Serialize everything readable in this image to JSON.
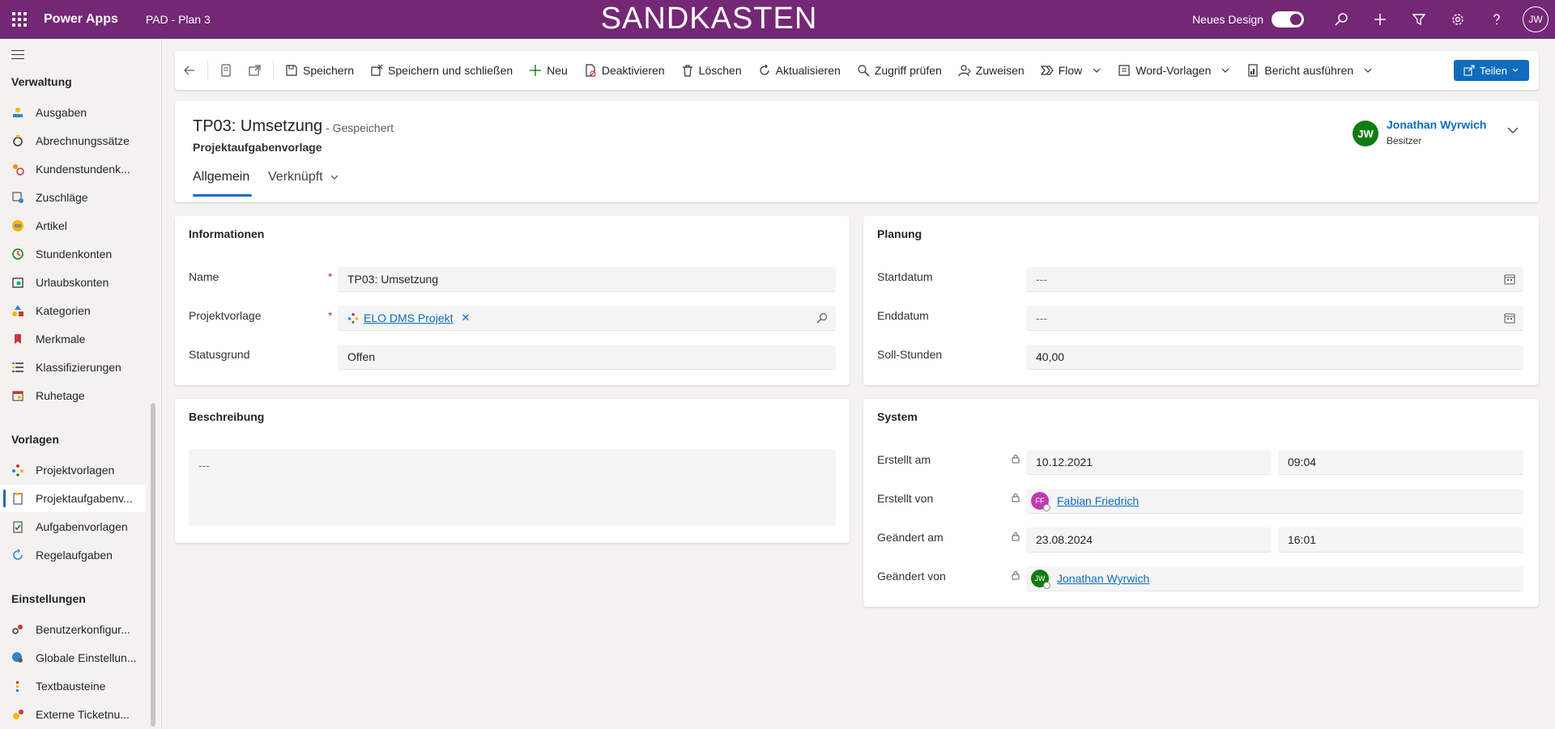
{
  "topbar": {
    "app_name": "Power Apps",
    "app_sub": "PAD - Plan 3",
    "env_title": "SANDKASTEN",
    "new_design_label": "Neues Design",
    "new_design_on": true,
    "user_initials": "JW"
  },
  "sidebar": {
    "groups": [
      {
        "label": "Verwaltung"
      },
      {
        "label": "Vorlagen"
      },
      {
        "label": "Einstellungen"
      }
    ],
    "items": [
      {
        "label": "Ausgaben",
        "icon": "expense-icon"
      },
      {
        "label": "Abrechnungssätze",
        "icon": "rate-icon"
      },
      {
        "label": "Kundenstundenk...",
        "icon": "customer-hours-icon"
      },
      {
        "label": "Zuschläge",
        "icon": "surcharge-icon"
      },
      {
        "label": "Artikel",
        "icon": "article-icon"
      },
      {
        "label": "Stundenkonten",
        "icon": "hours-account-icon"
      },
      {
        "label": "Urlaubskonten",
        "icon": "vacation-account-icon"
      },
      {
        "label": "Kategorien",
        "icon": "category-icon"
      },
      {
        "label": "Merkmale",
        "icon": "tag-icon"
      },
      {
        "label": "Klassifizierungen",
        "icon": "list-icon"
      },
      {
        "label": "Ruhetage",
        "icon": "calendar-icon"
      },
      {
        "label": "Projektvorlagen",
        "icon": "project-template-icon"
      },
      {
        "label": "Projektaufgabenv...",
        "icon": "project-task-template-icon",
        "active": true
      },
      {
        "label": "Aufgabenvorlagen",
        "icon": "task-template-icon"
      },
      {
        "label": "Regelaufgaben",
        "icon": "recurring-task-icon"
      },
      {
        "label": "Benutzerkonfigur...",
        "icon": "user-config-icon"
      },
      {
        "label": "Globale Einstellun...",
        "icon": "global-settings-icon"
      },
      {
        "label": "Textbausteine",
        "icon": "text-block-icon"
      },
      {
        "label": "Externe Ticketnu...",
        "icon": "ticket-icon"
      }
    ]
  },
  "commands": {
    "save": "Speichern",
    "save_close": "Speichern und schließen",
    "new": "Neu",
    "deactivate": "Deaktivieren",
    "delete": "Löschen",
    "refresh": "Aktualisieren",
    "check_access": "Zugriff prüfen",
    "assign": "Zuweisen",
    "flow": "Flow",
    "word_templates": "Word-Vorlagen",
    "run_report": "Bericht ausführen",
    "share": "Teilen"
  },
  "record": {
    "title": "TP03: Umsetzung",
    "saved_status": "- Gespeichert",
    "entity": "Projektaufgabenvorlage",
    "tabs": [
      "Allgemein",
      "Verknüpft"
    ],
    "owner_initials": "JW",
    "owner_name": "Jonathan Wyrwich",
    "owner_role": "Besitzer"
  },
  "info": {
    "title": "Informationen",
    "name_label": "Name",
    "name_value": "TP03: Umsetzung",
    "template_label": "Projektvorlage",
    "template_value": "ELO DMS Projekt",
    "status_label": "Statusgrund",
    "status_value": "Offen"
  },
  "description": {
    "title": "Beschreibung",
    "value": "---"
  },
  "planning": {
    "title": "Planung",
    "start_label": "Startdatum",
    "start_value": "---",
    "end_label": "Enddatum",
    "end_value": "---",
    "hours_label": "Soll-Stunden",
    "hours_value": "40,00"
  },
  "system": {
    "title": "System",
    "created_on_label": "Erstellt am",
    "created_on_date": "10.12.2021",
    "created_on_time": "09:04",
    "created_by_label": "Erstellt von",
    "created_by_initials": "FF",
    "created_by_name": "Fabian Friedrich",
    "modified_on_label": "Geändert am",
    "modified_on_date": "23.08.2024",
    "modified_on_time": "16:01",
    "modified_by_label": "Geändert von",
    "modified_by_initials": "JW",
    "modified_by_name": "Jonathan Wyrwich"
  },
  "colors": {
    "topbar": "#742774",
    "accent": "#0f6cbd",
    "owner_avatar": "#107c10",
    "ff_avatar": "#c239b3"
  }
}
